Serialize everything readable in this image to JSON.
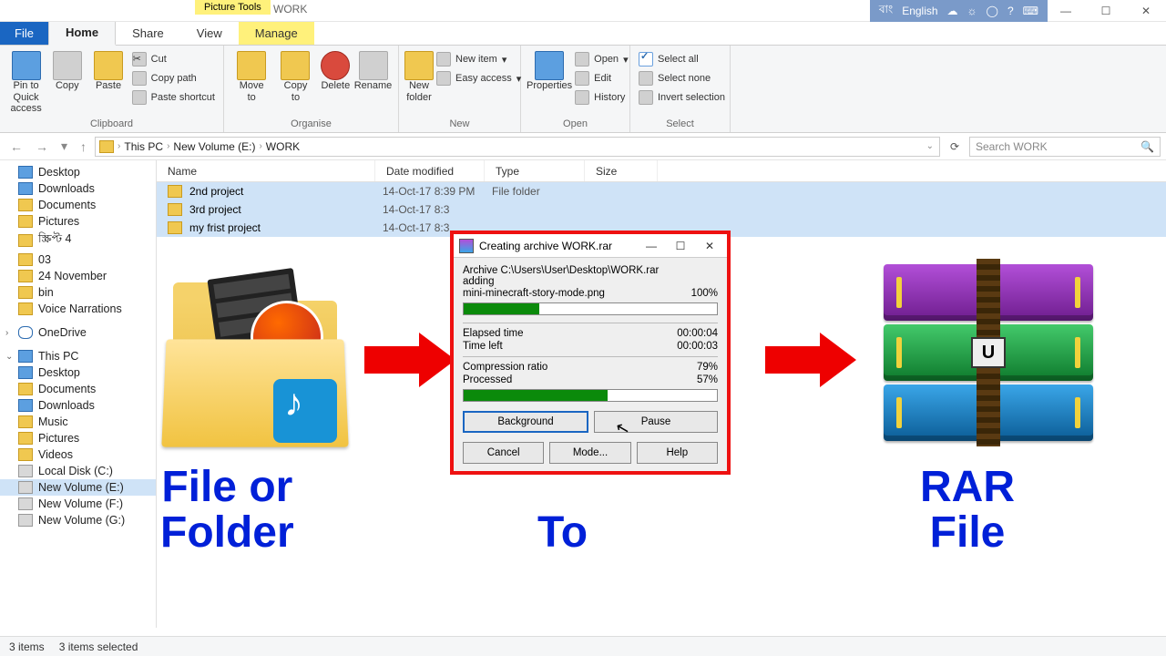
{
  "titlebar": {
    "tools": "Picture Tools",
    "window": "WORK",
    "lang_region": "বাং",
    "lang": "English"
  },
  "wctrl": {
    "min": "—",
    "max": "☐",
    "close": "✕"
  },
  "tabs": {
    "file": "File",
    "home": "Home",
    "share": "Share",
    "view": "View",
    "manage": "Manage"
  },
  "ribbon": {
    "clipboard": {
      "label": "Clipboard",
      "pin": "Pin to Quick\naccess",
      "copy": "Copy",
      "paste": "Paste",
      "cut": "Cut",
      "copypath": "Copy path",
      "pasteshortcut": "Paste shortcut"
    },
    "organise": {
      "label": "Organise",
      "moveto": "Move\nto",
      "copyto": "Copy\nto",
      "delete": "Delete",
      "rename": "Rename"
    },
    "new": {
      "label": "New",
      "newfolder": "New\nfolder",
      "newitem": "New item",
      "easyaccess": "Easy access"
    },
    "open": {
      "label": "Open",
      "properties": "Properties",
      "open": "Open",
      "edit": "Edit",
      "history": "History"
    },
    "select": {
      "label": "Select",
      "all": "Select all",
      "none": "Select none",
      "invert": "Invert selection"
    }
  },
  "breadcrumb": {
    "root": "This PC",
    "drive": "New Volume (E:)",
    "folder": "WORK",
    "search_placeholder": "Search WORK"
  },
  "columns": {
    "name": "Name",
    "date": "Date modified",
    "type": "Type",
    "size": "Size"
  },
  "files": [
    {
      "name": "2nd project",
      "date": "14-Oct-17 8:39 PM",
      "type": "File folder"
    },
    {
      "name": "3rd project",
      "date": "14-Oct-17 8:3",
      "type": ""
    },
    {
      "name": "my frist project",
      "date": "14-Oct-17 8:3",
      "type": ""
    }
  ],
  "tree": {
    "quick": [
      "Desktop",
      "Downloads",
      "Documents",
      "Pictures",
      "স্ক্রিপ্ট 4",
      "03",
      "24 November",
      "bin",
      "Voice Narrations"
    ],
    "onedrive": "OneDrive",
    "thispc": "This PC",
    "pc": [
      "Desktop",
      "Documents",
      "Downloads",
      "Music",
      "Pictures",
      "Videos",
      "Local Disk (C:)",
      "New Volume (E:)",
      "New Volume (F:)",
      "New Volume (G:)"
    ]
  },
  "dialog": {
    "title": "Creating archive WORK.rar",
    "archive_lbl": "Archive C:\\Users\\User\\Desktop\\WORK.rar",
    "adding": "adding",
    "file": "mini-minecraft-story-mode.png",
    "file_pct": "100%",
    "elapsed_lbl": "Elapsed time",
    "elapsed": "00:00:04",
    "left_lbl": "Time left",
    "left": "00:00:03",
    "ratio_lbl": "Compression ratio",
    "ratio": "79%",
    "proc_lbl": "Processed",
    "proc": "57%",
    "btn_bg": "Background",
    "btn_pause": "Pause",
    "btn_cancel": "Cancel",
    "btn_mode": "Mode...",
    "btn_help": "Help"
  },
  "overlay": {
    "left": "File or\nFolder",
    "mid": "To",
    "right": "RAR\nFile",
    "u": "U"
  },
  "status": {
    "count": "3 items",
    "sel": "3 items selected"
  }
}
